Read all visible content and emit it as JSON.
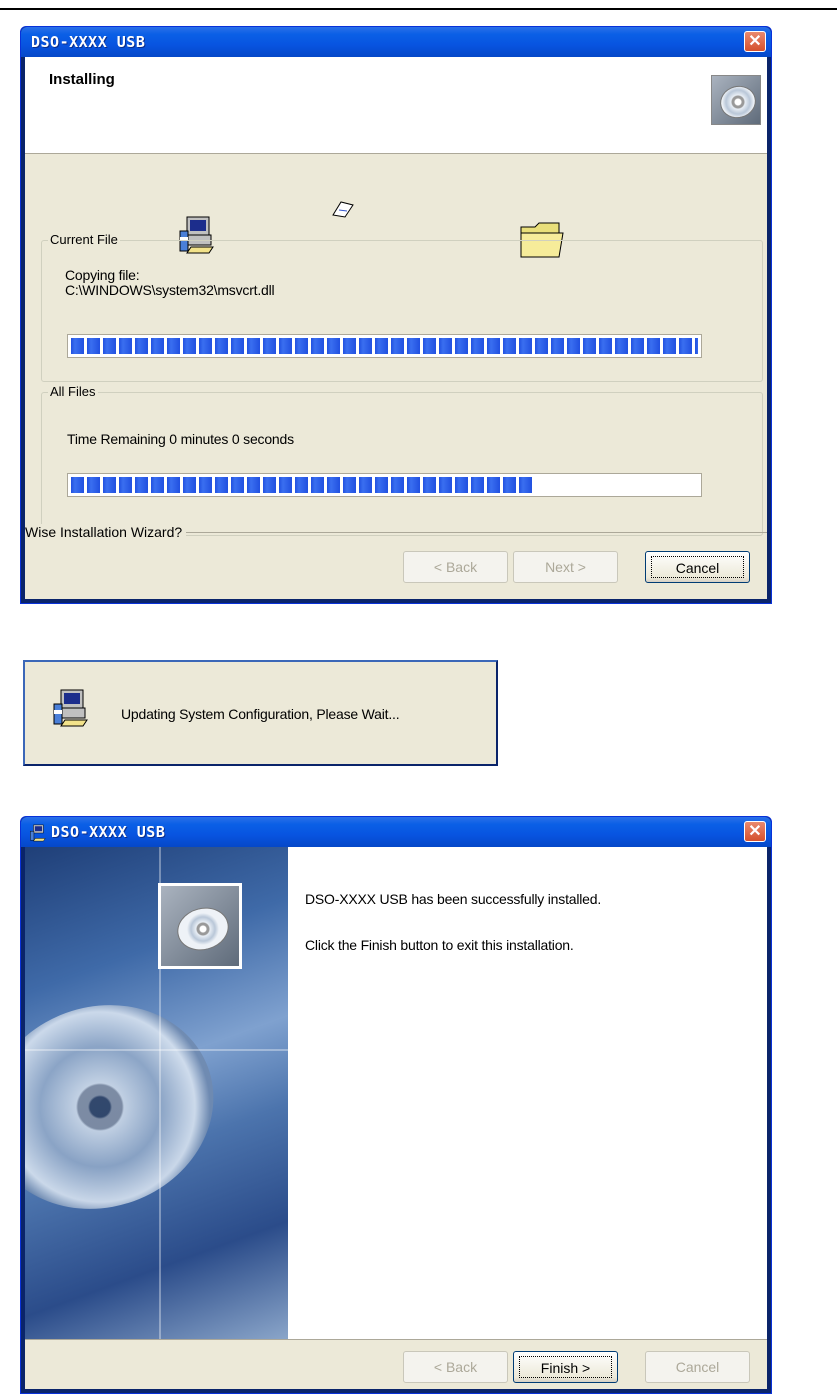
{
  "installing_window": {
    "title": "DSO-XXXX USB",
    "header_title": "Installing",
    "current_file_group": "Current File",
    "copying_label": "Copying file:",
    "copying_path": "C:\\WINDOWS\\system32\\msvcrt.dll",
    "current_file_progress": 1.0,
    "all_files_group": "All Files",
    "time_remaining": "Time Remaining 0 minutes 0 seconds",
    "all_files_progress": 0.74,
    "footer_label": "Wise Installation Wizard?",
    "back_label": "< Back",
    "next_label": "Next >",
    "cancel_label": "Cancel",
    "close_symbol": "✕"
  },
  "config_dialog": {
    "message": "Updating System Configuration, Please Wait..."
  },
  "finish_window": {
    "title": "DSO-XXXX USB",
    "success_text": "DSO-XXXX USB has been successfully installed.",
    "instruction_text": "Click the Finish button to exit this installation.",
    "back_label": "< Back",
    "finish_label": "Finish >",
    "cancel_label": "Cancel",
    "close_symbol": "✕"
  },
  "icons": [
    "installer-computer-icon",
    "paper-flying-icon",
    "folder-icon",
    "cd-icon",
    "close-icon"
  ],
  "colors": {
    "title_bar": "#0a5fe6",
    "progress": "#2150e0",
    "dialog_bg": "#ece9d8"
  }
}
